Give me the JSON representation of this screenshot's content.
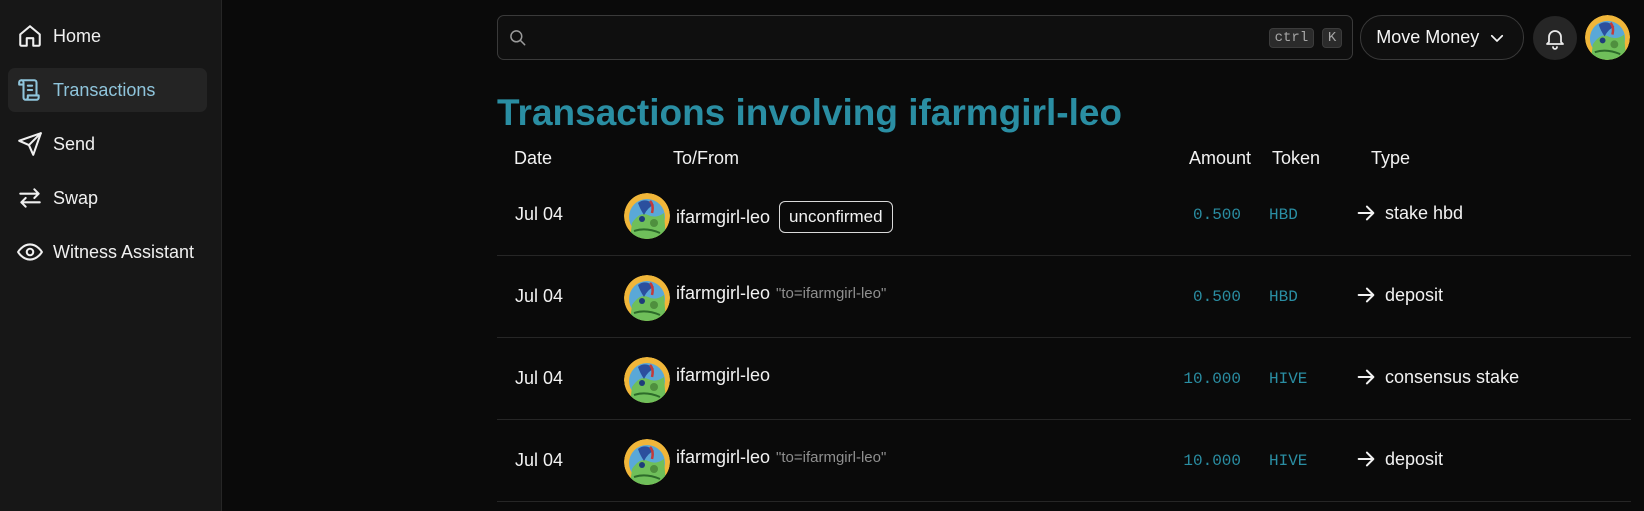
{
  "sidebar": {
    "items": [
      {
        "label": "Home",
        "icon": "home-icon",
        "active": false
      },
      {
        "label": "Transactions",
        "icon": "scroll-icon",
        "active": true
      },
      {
        "label": "Send",
        "icon": "send-icon",
        "active": false
      },
      {
        "label": "Swap",
        "icon": "swap-icon",
        "active": false
      },
      {
        "label": "Witness Assistant",
        "icon": "eye-icon",
        "active": false
      }
    ]
  },
  "header": {
    "search": {
      "placeholder": "",
      "value": "",
      "shortcut_ctrl": "ctrl",
      "shortcut_key": "K"
    },
    "move_money_label": "Move Money",
    "bell_icon": "bell-icon"
  },
  "page": {
    "title": "Transactions involving ifarmgirl-leo"
  },
  "table": {
    "headers": {
      "date": "Date",
      "to_from": "To/From",
      "amount": "Amount",
      "token": "Token",
      "type": "Type"
    },
    "rows": [
      {
        "date": "Jul 04",
        "account": "ifarmgirl-leo",
        "memo": "",
        "badge": "unconfirmed",
        "amount": "0.500",
        "token": "HBD",
        "type": "stake hbd"
      },
      {
        "date": "Jul 04",
        "account": "ifarmgirl-leo",
        "memo": "\"to=ifarmgirl-leo\"",
        "badge": "",
        "amount": "0.500",
        "token": "HBD",
        "type": "deposit"
      },
      {
        "date": "Jul 04",
        "account": "ifarmgirl-leo",
        "memo": "",
        "badge": "",
        "amount": "10.000",
        "token": "HIVE",
        "type": "consensus stake"
      },
      {
        "date": "Jul 04",
        "account": "ifarmgirl-leo",
        "memo": "\"to=ifarmgirl-leo\"",
        "badge": "",
        "amount": "10.000",
        "token": "HIVE",
        "type": "deposit"
      }
    ]
  },
  "colors": {
    "accent": "#2a8ea3",
    "active_nav": "#8fc5dc",
    "background": "#0a0a0a",
    "sidebar": "#171717"
  }
}
